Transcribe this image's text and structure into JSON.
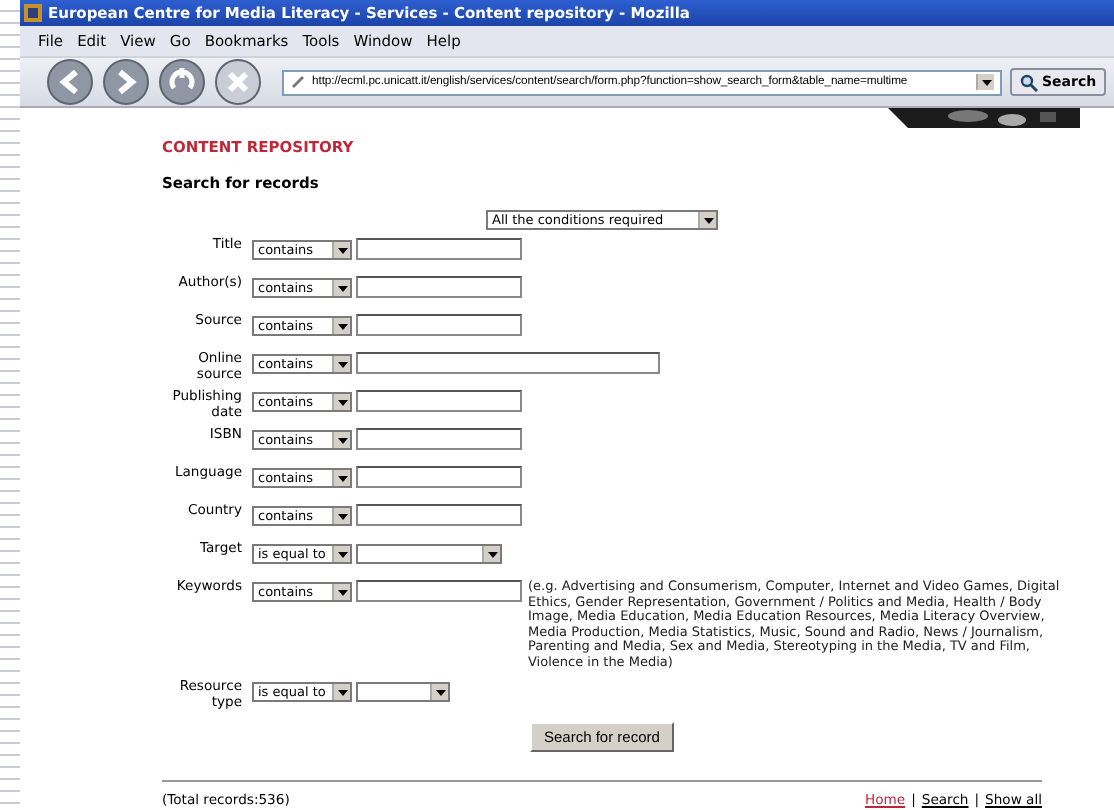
{
  "window": {
    "title": "European Centre for Media Literacy - Services - Content repository - Mozilla"
  },
  "menu": [
    "File",
    "Edit",
    "View",
    "Go",
    "Bookmarks",
    "Tools",
    "Window",
    "Help"
  ],
  "toolbar": {
    "buttons": [
      {
        "kind": "back",
        "disabled": false
      },
      {
        "kind": "forward",
        "disabled": false
      },
      {
        "kind": "reload",
        "disabled": false
      },
      {
        "kind": "stop",
        "disabled": true
      }
    ],
    "address": "http://ecml.pc.unicatt.it/english/services/content/search/form.php?function=show_search_form&table_name=multime",
    "search_label": "Search"
  },
  "page": {
    "heading": "CONTENT REPOSITORY",
    "subheading": "Search for records",
    "match_mode": "All the conditions required",
    "fields": [
      {
        "label": "Title",
        "operator": "contains",
        "kind": "text"
      },
      {
        "label": "Author(s)",
        "operator": "contains",
        "kind": "text"
      },
      {
        "label": "Source",
        "operator": "contains",
        "kind": "text"
      },
      {
        "label": "Online source",
        "operator": "contains",
        "kind": "wide"
      },
      {
        "label": "Publishing date",
        "operator": "contains",
        "kind": "text"
      },
      {
        "label": "ISBN",
        "operator": "contains",
        "kind": "text"
      },
      {
        "label": "Language",
        "operator": "contains",
        "kind": "text"
      },
      {
        "label": "Country",
        "operator": "contains",
        "kind": "text"
      },
      {
        "label": "Target",
        "operator": "is equal to",
        "kind": "select"
      },
      {
        "label": "Keywords",
        "operator": "contains",
        "kind": "text",
        "hint": "(e.g. Advertising and Consumerism, Computer, Internet and Video Games, Digital Ethics, Gender Representation, Government / Politics and Media, Health / Body Image, Media Education, Media Education Resources, Media Literacy Overview, Media Production, Media Statistics, Music, Sound and Radio, News / Journalism, Parenting and Media, Sex and Media, Stereotyping in the Media, TV and Film, Violence in the Media)"
      },
      {
        "label": "Resource type",
        "operator": "is equal to",
        "kind": "small-select"
      }
    ],
    "submit": "Search for record",
    "total": "(Total records:536)",
    "footer_separator": "|",
    "footer_links": [
      {
        "label": "Home",
        "current": true
      },
      {
        "label": "Search",
        "current": false
      },
      {
        "label": "Show all",
        "current": false
      }
    ]
  }
}
